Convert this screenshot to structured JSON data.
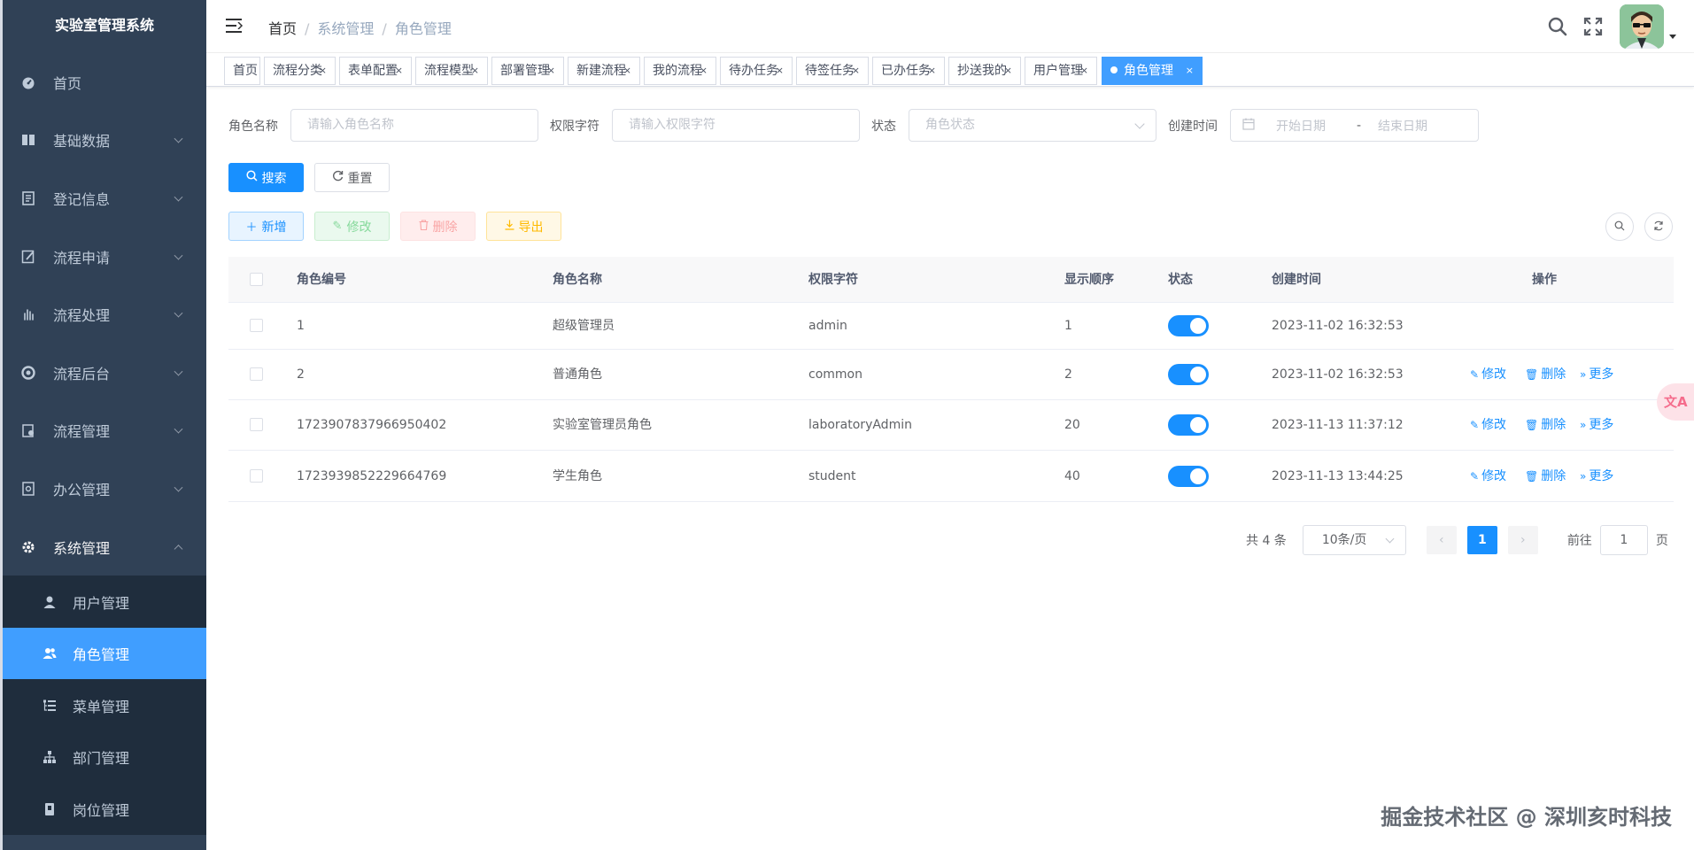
{
  "app": {
    "title": "实验室管理系统"
  },
  "sidebar": {
    "items": [
      {
        "label": "首页",
        "icon": "dashboard-icon"
      },
      {
        "label": "基础数据",
        "icon": "book-icon"
      },
      {
        "label": "登记信息",
        "icon": "document-icon"
      },
      {
        "label": "流程申请",
        "icon": "edit-form-icon"
      },
      {
        "label": "流程处理",
        "icon": "hand-icon"
      },
      {
        "label": "流程后台",
        "icon": "lifebuoy-icon"
      },
      {
        "label": "流程管理",
        "icon": "clipboard-icon"
      },
      {
        "label": "办公管理",
        "icon": "office-icon"
      },
      {
        "label": "系统管理",
        "icon": "gear-icon"
      }
    ],
    "sub_items": [
      {
        "label": "用户管理",
        "icon": "user-icon"
      },
      {
        "label": "角色管理",
        "icon": "peoples-icon"
      },
      {
        "label": "菜单管理",
        "icon": "tree-table-icon"
      },
      {
        "label": "部门管理",
        "icon": "tree-icon"
      },
      {
        "label": "岗位管理",
        "icon": "post-icon"
      }
    ]
  },
  "breadcrumb": {
    "home": "首页",
    "level1": "系统管理",
    "level2": "角色管理",
    "separator": "/"
  },
  "tags": [
    {
      "label": "首页"
    },
    {
      "label": "流程分类",
      "close": "×"
    },
    {
      "label": "表单配置",
      "close": "×"
    },
    {
      "label": "流程模型",
      "close": "×"
    },
    {
      "label": "部署管理",
      "close": "×"
    },
    {
      "label": "新建流程",
      "close": "×"
    },
    {
      "label": "我的流程",
      "close": "×"
    },
    {
      "label": "待办任务",
      "close": "×"
    },
    {
      "label": "待签任务",
      "close": "×"
    },
    {
      "label": "已办任务",
      "close": "×"
    },
    {
      "label": "抄送我的",
      "close": "×"
    },
    {
      "label": "用户管理",
      "close": "×"
    },
    {
      "label": "角色管理",
      "close": "×"
    }
  ],
  "search": {
    "role_name_label": "角色名称",
    "role_name_placeholder": "请输入角色名称",
    "perm_label": "权限字符",
    "perm_placeholder": "请输入权限字符",
    "status_label": "状态",
    "status_placeholder": "角色状态",
    "created_label": "创建时间",
    "start_placeholder": "开始日期",
    "range_sep": "-",
    "end_placeholder": "结束日期",
    "search_btn": "搜索",
    "reset_btn": "重置"
  },
  "toolbar": {
    "add": "新增",
    "edit": "修改",
    "delete": "删除",
    "export": "导出"
  },
  "table": {
    "columns": [
      "角色编号",
      "角色名称",
      "权限字符",
      "显示顺序",
      "状态",
      "创建时间",
      "操作"
    ],
    "rows": [
      {
        "id": "1",
        "name": "超级管理员",
        "key": "admin",
        "sort": "1",
        "status_on": true,
        "created": "2023-11-02 16:32:53",
        "has_ops": false
      },
      {
        "id": "2",
        "name": "普通角色",
        "key": "common",
        "sort": "2",
        "status_on": true,
        "created": "2023-11-02 16:32:53",
        "has_ops": true
      },
      {
        "id": "1723907837966950402",
        "name": "实验室管理员角色",
        "key": "laboratoryAdmin",
        "sort": "20",
        "status_on": true,
        "created": "2023-11-13 11:37:12",
        "has_ops": true
      },
      {
        "id": "1723939852229664769",
        "name": "学生角色",
        "key": "student",
        "sort": "40",
        "status_on": true,
        "created": "2023-11-13 13:44:25",
        "has_ops": true
      }
    ],
    "ops": {
      "edit": "修改",
      "delete": "删除",
      "more": "更多"
    }
  },
  "pagination": {
    "total": "共 4 条",
    "page_size": "10条/页",
    "current": "1",
    "goto_label": "前往",
    "goto_value": "1",
    "page_suffix": "页"
  },
  "watermark": "掘金技术社区 @ 深圳亥时科技",
  "translate_badge": "文A",
  "colors": {
    "primary": "#1890ff",
    "sidebar_bg": "#304156",
    "submenu_bg": "#1f2d3d",
    "active_menu": "#409eff"
  }
}
